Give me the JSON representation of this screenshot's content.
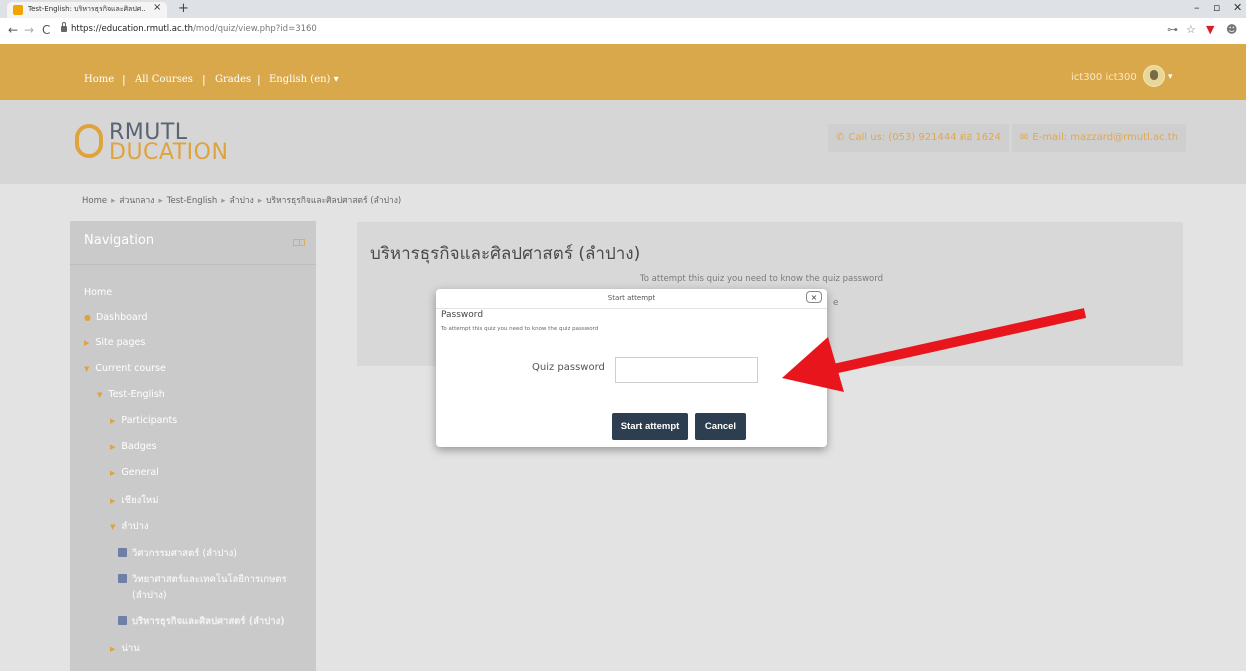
{
  "browser": {
    "tab_title": "Test-English: บริหารธุรกิจและศิลปศ...",
    "tab_close": "×",
    "new_tab": "+",
    "url_domain": "https://education.rmutl.ac.th",
    "url_path": "/mod/quiz/view.php?id=3160",
    "back": "←",
    "forward": "→",
    "reload": "C",
    "minimize": "–",
    "restore": "▫",
    "close": "✕"
  },
  "topnav": {
    "home": "Home",
    "all_courses": "All Courses",
    "grades": "Grades",
    "language": "English (en) ▾",
    "separator": "|",
    "user": "ict300 ict300",
    "user_caret": "▾"
  },
  "header": {
    "logo_top": "RMUTL",
    "logo_bottom": "DUCATION",
    "phone": "Call us: (053) 921444 ต่อ 1624",
    "email": "E-mail: mazzard@rmutl.ac.th"
  },
  "breadcrumb": [
    "Home",
    "ส่วนกลาง",
    "Test-English",
    "ลำปาง",
    "บริหารธุรกิจและศิลปศาสตร์ (ลำปาง)"
  ],
  "breadcrumb_sep": "▸",
  "navigation": {
    "title": "Navigation",
    "items": [
      {
        "label": "Home"
      },
      {
        "label": "Dashboard"
      },
      {
        "label": "Site pages"
      },
      {
        "label": "Current course"
      },
      {
        "label": "Test-English"
      },
      {
        "label": "Participants"
      },
      {
        "label": "Badges"
      },
      {
        "label": "General"
      },
      {
        "label": "เชียงใหม่"
      },
      {
        "label": "ลำปาง"
      },
      {
        "label": "วิศวกรรมศาสตร์ (ลำปาง)"
      },
      {
        "label": "วิทยาศาสตร์และเทคโนโลยีการเกษตร"
      },
      {
        "label": "(ลำปาง)"
      },
      {
        "label": "บริหารธุรกิจและศิลปศาสตร์ (ลำปาง)"
      },
      {
        "label": "น่าน"
      }
    ]
  },
  "main": {
    "title": "บริหารธุรกิจและศิลปศาสตร์ (ลำปาง)",
    "info": "To attempt this quiz you need to know the quiz password",
    "info_tail": "e"
  },
  "modal": {
    "title": "Start attempt",
    "close": "×",
    "legend": "Password",
    "description": "To attempt this quiz you need to know the quiz password",
    "password_label": "Quiz password",
    "password_value": "",
    "start_button": "Start attempt",
    "cancel_button": "Cancel"
  },
  "colors": {
    "topnav": "#d9a84a",
    "button": "#2c3e50",
    "arrow": "#e8161c"
  }
}
